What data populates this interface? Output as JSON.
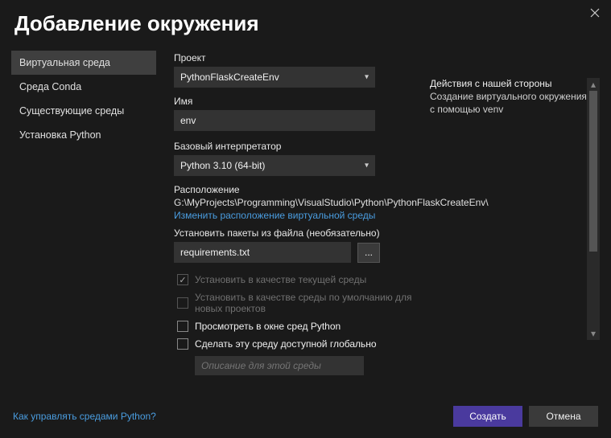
{
  "title": "Добавление окружения",
  "sidebar": {
    "items": [
      {
        "label": "Виртуальная среда",
        "selected": true
      },
      {
        "label": "Среда Conda",
        "selected": false
      },
      {
        "label": "Существующие среды",
        "selected": false
      },
      {
        "label": "Установка Python",
        "selected": false
      }
    ]
  },
  "form": {
    "project_label": "Проект",
    "project_value": "PythonFlaskCreateEnv",
    "name_label": "Имя",
    "name_value": "env",
    "interpreter_label": "Базовый интерпретатор",
    "interpreter_value": "Python 3.10 (64-bit)",
    "location_label": "Расположение",
    "location_path": "G:\\MyProjects\\Programming\\VisualStudio\\Python\\PythonFlaskCreateEnv\\",
    "change_location_link": "Изменить расположение виртуальной среды",
    "packages_label": "Установить пакеты из файла (необязательно)",
    "packages_value": "requirements.txt",
    "browse_label": "...",
    "checks": {
      "set_current": {
        "label": "Установить в качестве текущей среды",
        "checked": true,
        "disabled": true
      },
      "set_default": {
        "label": "Установить в качестве среды по умолчанию для новых проектов",
        "checked": false,
        "disabled": true
      },
      "view_window": {
        "label": "Просмотреть в окне сред Python",
        "checked": false,
        "disabled": false
      },
      "make_global": {
        "label": "Сделать эту среду доступной глобально",
        "checked": false,
        "disabled": false
      }
    },
    "description_placeholder": "Описание для этой среды"
  },
  "info": {
    "heading": "Действия с нашей стороны",
    "desc": "Создание виртуального окружения с помощью venv"
  },
  "footer": {
    "help_link": "Как управлять средами Python?",
    "create": "Создать",
    "cancel": "Отмена"
  }
}
